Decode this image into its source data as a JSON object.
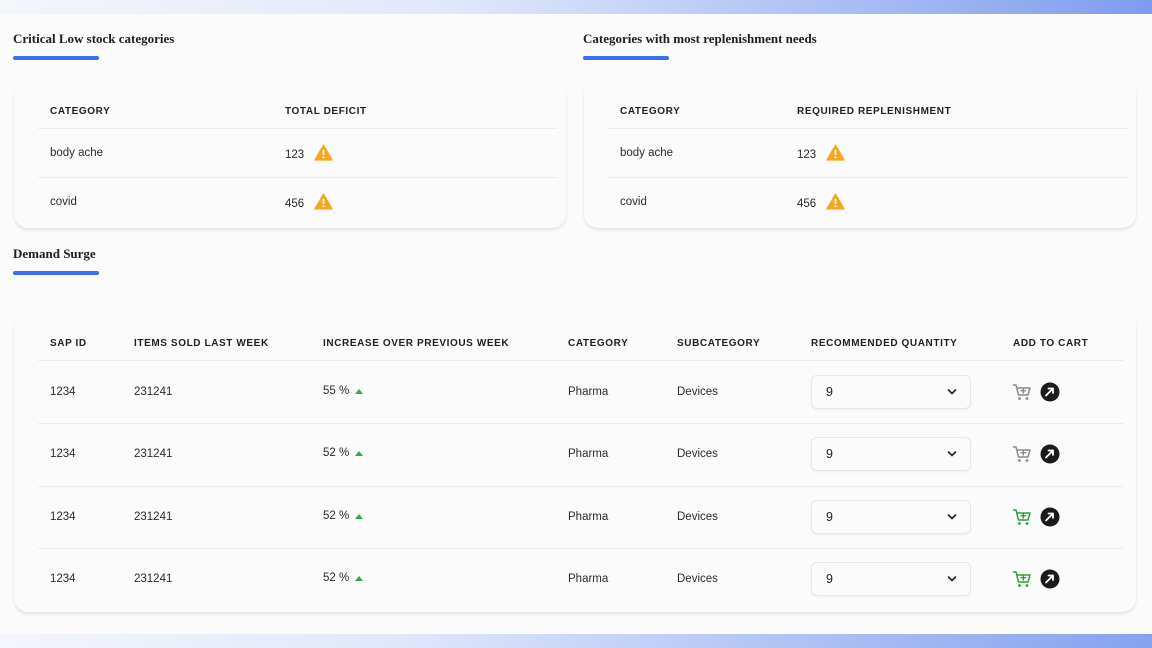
{
  "critical_low": {
    "title": "Critical Low stock categories",
    "headers": [
      "CATEGORY",
      "TOTAL DEFICIT"
    ],
    "rows": [
      {
        "category": "body ache",
        "value": "123"
      },
      {
        "category": "covid",
        "value": "456"
      }
    ]
  },
  "replenishment": {
    "title": "Categories with most replenishment needs",
    "headers": [
      "CATEGORY",
      "REQUIRED REPLENISHMENT"
    ],
    "rows": [
      {
        "category": "body ache",
        "value": "123"
      },
      {
        "category": "covid",
        "value": "456"
      }
    ]
  },
  "demand_surge": {
    "title": "Demand Surge",
    "headers": [
      "SAP ID",
      "ITEMS SOLD LAST WEEK",
      "INCREASE OVER PREVIOUS WEEK",
      "CATEGORY",
      "SUBCATEGORY",
      "RECOMMENDED QUANTITY",
      "ADD TO CART"
    ],
    "rows": [
      {
        "sap_id": "1234",
        "items_sold": "231241",
        "increase": "55 %",
        "category": "Pharma",
        "subcategory": "Devices",
        "quantity": "9",
        "cart_state": "inactive"
      },
      {
        "sap_id": "1234",
        "items_sold": "231241",
        "increase": "52 %",
        "category": "Pharma",
        "subcategory": "Devices",
        "quantity": "9",
        "cart_state": "inactive"
      },
      {
        "sap_id": "1234",
        "items_sold": "231241",
        "increase": "52 %",
        "category": "Pharma",
        "subcategory": "Devices",
        "quantity": "9",
        "cart_state": "active"
      },
      {
        "sap_id": "1234",
        "items_sold": "231241",
        "increase": "52 %",
        "category": "Pharma",
        "subcategory": "Devices",
        "quantity": "9",
        "cart_state": "active"
      }
    ]
  },
  "icons": {
    "warning": "warning-icon",
    "trend": "arrow-up-icon",
    "dropdown": "chevron-down-icon",
    "cart": "add-to-cart-icon",
    "go": "go-arrow-icon"
  },
  "colors": {
    "accent": "#3d6df0",
    "warning": "#f5a623",
    "trend_up": "#3aa54a",
    "cart_active": "#2e9e3e",
    "cart_inactive": "#8a8a8a"
  }
}
